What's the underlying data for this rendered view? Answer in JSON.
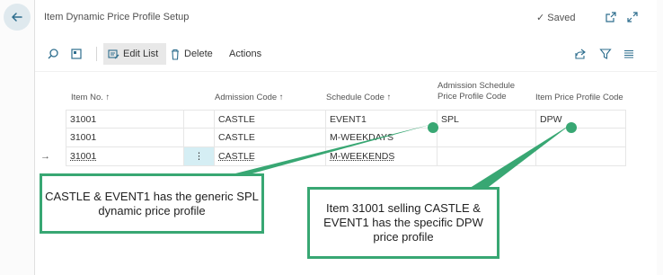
{
  "page": {
    "title": "Item Dynamic Price Profile Setup",
    "saved": "Saved"
  },
  "toolbar": {
    "edit_list": "Edit List",
    "delete": "Delete",
    "actions": "Actions"
  },
  "columns": {
    "item_no": "Item No. ↑",
    "admission_code": "Admission Code ↑",
    "schedule_code": "Schedule Code ↑",
    "admission_schedule_profile_line1": "Admission Schedule",
    "admission_schedule_profile_line2": "Price Profile Code",
    "item_price_profile": "Item Price Profile Code"
  },
  "rows": [
    {
      "item_no": "31001",
      "admission_code": "CASTLE",
      "schedule_code": "EVENT1",
      "admission_schedule_profile": "SPL",
      "item_price_profile": "DPW"
    },
    {
      "item_no": "31001",
      "admission_code": "CASTLE",
      "schedule_code": "M-WEEKDAYS",
      "admission_schedule_profile": "",
      "item_price_profile": ""
    },
    {
      "item_no": "31001",
      "admission_code": "CASTLE",
      "schedule_code": "M-WEEKENDS",
      "admission_schedule_profile": "",
      "item_price_profile": ""
    }
  ],
  "row_marker": "→",
  "row_menu": "⋮",
  "callouts": {
    "left": "CASTLE & EVENT1 has the generic SPL dynamic price profile",
    "right": "Item 31001 selling CASTLE & EVENT1 has the specific DPW price profile"
  },
  "colors": {
    "accent": "#38a773",
    "back_button_bg": "#dfe9ee",
    "icon": "#2e6e8e",
    "selected_cell": "#d5eef4"
  },
  "icons": [
    "back-arrow-icon",
    "checkmark-icon",
    "open-new-window-icon",
    "expand-icon",
    "search-icon",
    "view-icon",
    "edit-list-icon",
    "trash-icon",
    "share-icon",
    "filter-icon",
    "list-icon"
  ]
}
